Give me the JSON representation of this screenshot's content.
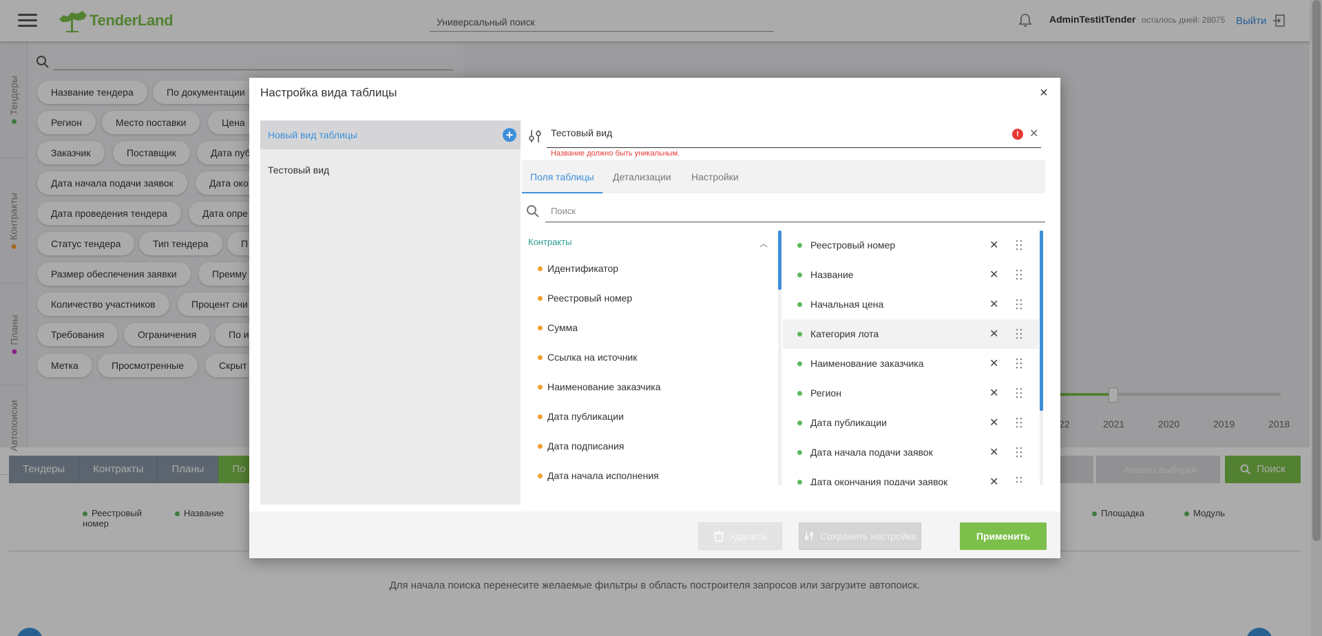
{
  "header": {
    "logo": "TenderLand",
    "search_placeholder": "Универсальный поиск",
    "user": "AdminTestitTender",
    "days_left": "осталось дней: 28075",
    "logout": "Выйти"
  },
  "vtabs": [
    {
      "label": "Тендеры",
      "dot": "#5cb85c"
    },
    {
      "label": "Контракты",
      "dot": "#f0a030"
    },
    {
      "label": "Планы",
      "dot": "#cc33cc"
    },
    {
      "label": "Автопоиски",
      "dot": "#ffffff"
    }
  ],
  "filter_chips": [
    [
      "Название тендера",
      "По документации"
    ],
    [
      "Регион",
      "Место поставки",
      "Цена"
    ],
    [
      "Заказчик",
      "Поставщик",
      "Дата пуб"
    ],
    [
      "Дата начала подачи заявок",
      "Дата око"
    ],
    [
      "Дата проведения тендера",
      "Дата опре"
    ],
    [
      "Статус тендера",
      "Тип тендера",
      "П"
    ],
    [
      "Размер обеспечения заявки",
      "Преиму"
    ],
    [
      "Количество участников",
      "Процент сни"
    ],
    [
      "Требования",
      "Ограничения",
      "По и"
    ],
    [
      "Метка",
      "Просмотренные",
      "Скрыт"
    ]
  ],
  "years": [
    "22",
    "2021",
    "2020",
    "2019",
    "2018"
  ],
  "bottom_tabs": [
    "Тендеры",
    "Контракты",
    "Планы",
    "По"
  ],
  "analysis_label": "Анализ выборки",
  "search_button": "Поиск",
  "columns_row": [
    "Реестровый номер",
    "Название",
    "Площадка",
    "Модуль"
  ],
  "hint": "Для начала поиска перенесите желаемые фильтры в область построителя запросов или загрузите автопоиск.",
  "modal": {
    "title": "Настройка вида таблицы",
    "close": "×",
    "views": {
      "new_view": "Новый вид таблицы",
      "items": [
        "Тестовый вид"
      ]
    },
    "name_value": "Тестовый вид",
    "name_error": "Название должно быть уникальным.",
    "tabs": [
      "Поля таблицы",
      "Детализации",
      "Настройки"
    ],
    "search_placeholder": "Поиск",
    "group": "Контракты",
    "available": [
      "Идентификатор",
      "Реестровый номер",
      "Сумма",
      "Ссылка на источник",
      "Наименование заказчика",
      "Дата публикации",
      "Дата подписания",
      "Дата начала исполнения"
    ],
    "selected": [
      "Реестровый номер",
      "Название",
      "Начальная цена",
      "Категория лота",
      "Наименование заказчика",
      "Регион",
      "Дата публикации",
      "Дата начала подачи заявок",
      "Дата окончания подачи заявок"
    ],
    "buttons": {
      "delete": "Удалить",
      "save": "Сохранить настройки",
      "apply": "Применить"
    }
  }
}
